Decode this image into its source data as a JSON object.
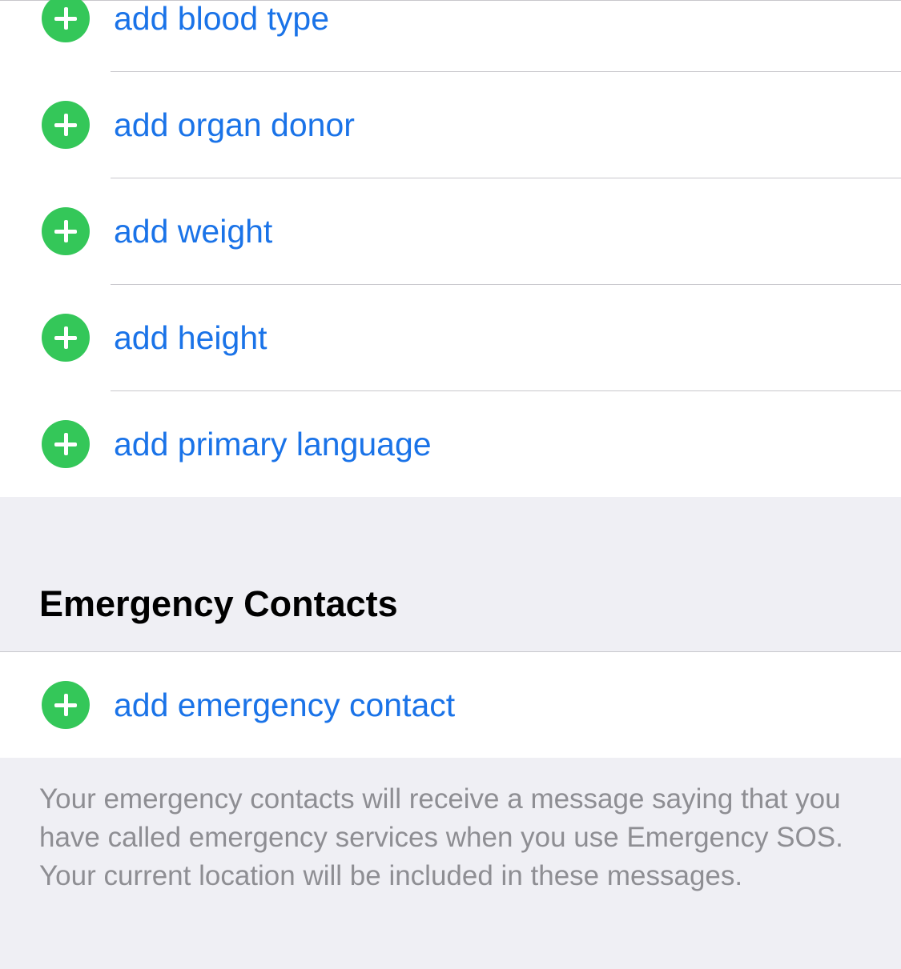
{
  "medical_id": {
    "rows": [
      {
        "label": "add blood type"
      },
      {
        "label": "add organ donor"
      },
      {
        "label": "add weight"
      },
      {
        "label": "add height"
      },
      {
        "label": "add primary language"
      }
    ]
  },
  "emergency_contacts": {
    "header": "Emergency Contacts",
    "add_label": "add emergency contact",
    "footer": "Your emergency contacts will receive a message saying that you have called emergency services when you use Emergency SOS. Your current location will be included in these messages."
  },
  "icons": {
    "add": "plus-circle-icon"
  },
  "colors": {
    "accent": "#1a73e8",
    "add_icon": "#34c759",
    "background": "#efeff4",
    "secondary_text": "#8e8e93"
  }
}
